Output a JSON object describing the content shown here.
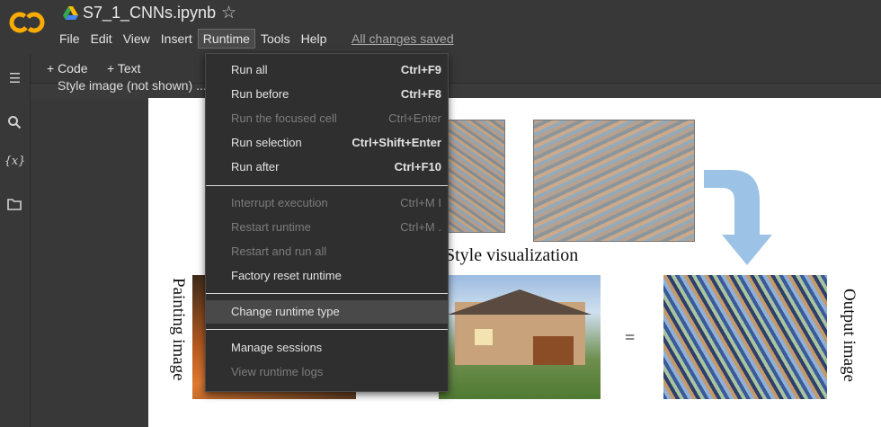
{
  "header": {
    "notebook_title": "S7_1_CNNs.ipynb",
    "save_status": "All changes saved",
    "menu": [
      "File",
      "Edit",
      "View",
      "Insert",
      "Runtime",
      "Tools",
      "Help"
    ]
  },
  "toolbar": {
    "code_label": "+ Code",
    "text_label": "+ Text"
  },
  "sidebar": {
    "variables_label": "{x}"
  },
  "cell": {
    "partial_text": "Style image (not shown) ... using the information from the filters."
  },
  "figure": {
    "style_visualization_label": "Style visualization",
    "painting_label": "Painting image",
    "equals_label": "=",
    "output_label": "Output image"
  },
  "runtime_menu": {
    "groups": [
      [
        {
          "label": "Run all",
          "shortcut": "Ctrl+F9",
          "enabled": true
        },
        {
          "label": "Run before",
          "shortcut": "Ctrl+F8",
          "enabled": true
        },
        {
          "label": "Run the focused cell",
          "shortcut": "Ctrl+Enter",
          "enabled": false
        },
        {
          "label": "Run selection",
          "shortcut": "Ctrl+Shift+Enter",
          "enabled": true
        },
        {
          "label": "Run after",
          "shortcut": "Ctrl+F10",
          "enabled": true
        }
      ],
      [
        {
          "label": "Interrupt execution",
          "shortcut": "Ctrl+M I",
          "enabled": false
        },
        {
          "label": "Restart runtime",
          "shortcut": "Ctrl+M .",
          "enabled": false
        },
        {
          "label": "Restart and run all",
          "shortcut": "",
          "enabled": false
        },
        {
          "label": "Factory reset runtime",
          "shortcut": "",
          "enabled": true
        }
      ],
      [
        {
          "label": "Change runtime type",
          "shortcut": "",
          "enabled": true
        }
      ],
      [
        {
          "label": "Manage sessions",
          "shortcut": "",
          "enabled": true
        },
        {
          "label": "View runtime logs",
          "shortcut": "",
          "enabled": false
        }
      ]
    ]
  },
  "colors": {
    "background": "#383838",
    "menu_background": "#2f2f2f",
    "logo_orange": "#f9ab00",
    "arrow_blue": "#9cc3e6"
  }
}
